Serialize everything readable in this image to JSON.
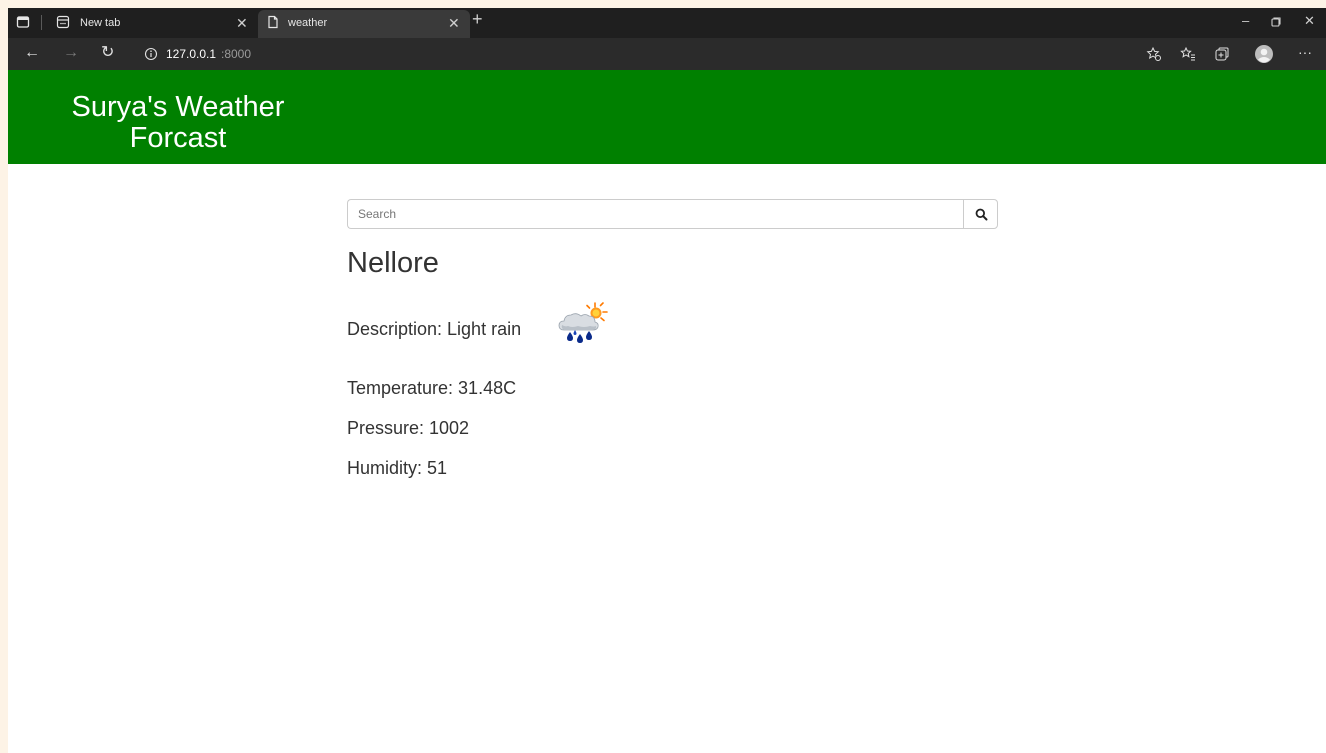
{
  "browser": {
    "tabs": [
      {
        "label": "New tab",
        "active": false
      },
      {
        "label": "weather",
        "active": true
      }
    ],
    "address": {
      "host": "127.0.0.1",
      "port": ":8000"
    }
  },
  "header": {
    "title_line1": "Surya's Weather",
    "title_line2": "Forcast"
  },
  "search": {
    "placeholder": "Search"
  },
  "weather": {
    "city": "Nellore",
    "description": "Description: Light rain",
    "temperature": "Temperature: 31.48C",
    "pressure": "Pressure: 1002",
    "humidity": "Humidity: 51"
  },
  "icons": {
    "sidebar": "sidebar-icon",
    "new_tab_page": "new-tab-page-icon",
    "document": "document-icon",
    "close": "close-icon",
    "plus": "plus-icon",
    "back": "back-arrow-icon",
    "forward": "forward-arrow-icon",
    "refresh": "refresh-icon",
    "info": "info-icon",
    "favorite_add": "add-favorite-icon",
    "favorites": "favorites-icon",
    "collections": "collections-icon",
    "profile": "profile-icon",
    "more": "more-icon",
    "search": "search-icon",
    "weather": "light-rain-weather-icon"
  },
  "colors": {
    "header": "#008000",
    "tabbar": "#1f1f1f",
    "toolbar": "#2b2b2b",
    "text": "#333333"
  }
}
